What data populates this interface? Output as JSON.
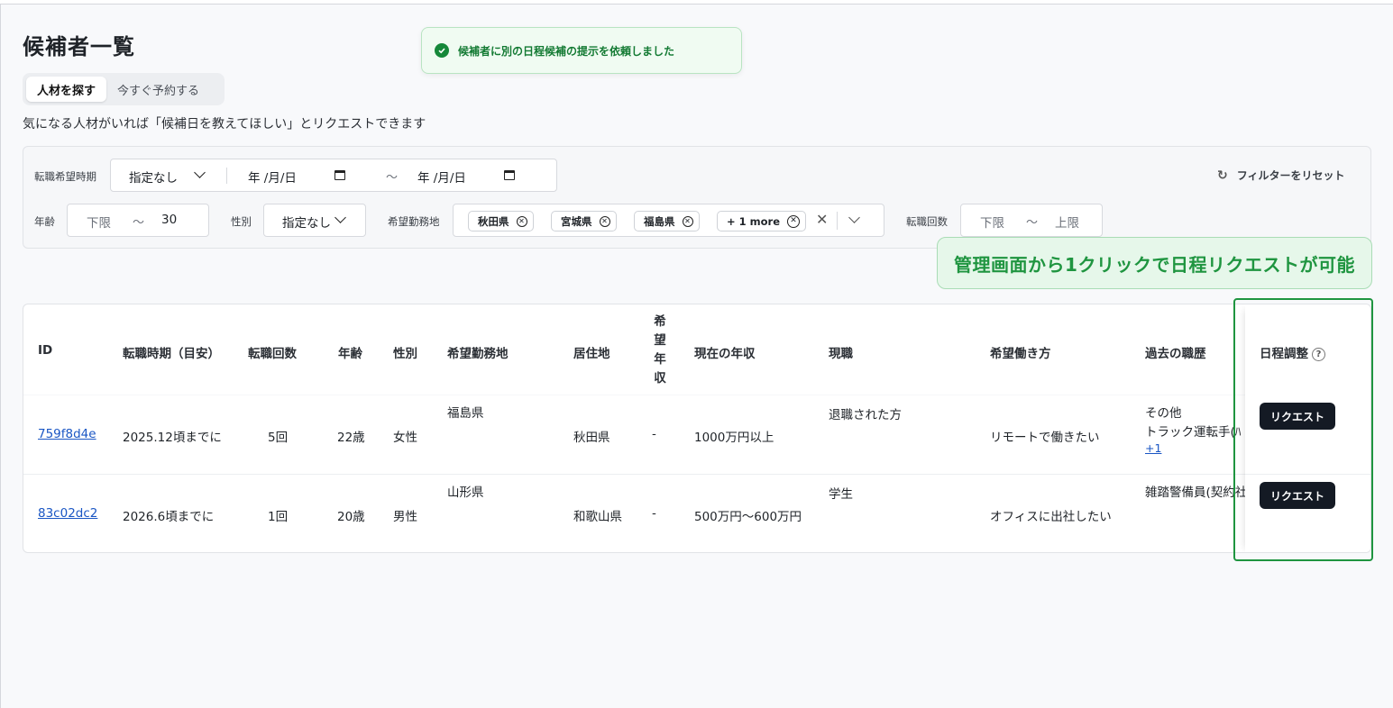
{
  "page": {
    "title": "候補者一覧"
  },
  "tabs": [
    {
      "label": "人材を探す",
      "active": true
    },
    {
      "label": "今すぐ予約する",
      "active": false
    }
  ],
  "subtitle": "気になる人材がいれば「候補日を教えてほしい」とリクエストできます",
  "toast": {
    "message": "候補者に別の日程候補の提示を依頼しました",
    "icon": "check-circle-icon"
  },
  "filters": {
    "change_period": {
      "label": "転職希望時期",
      "select_value": "指定なし",
      "date_from": "年 /月/日",
      "date_to": "年 /月/日",
      "separator": "～"
    },
    "age": {
      "label": "年齢",
      "min_placeholder": "下限",
      "separator": "～",
      "max_value": "30"
    },
    "gender": {
      "label": "性別",
      "select_value": "指定なし"
    },
    "location": {
      "label": "希望勤務地",
      "chips": [
        "秋田県",
        "宮城県",
        "福島県"
      ],
      "more": "+ 1 more"
    },
    "job_changes": {
      "label": "転職回数",
      "min_placeholder": "下限",
      "separator": "～",
      "max_placeholder": "上限"
    },
    "reset_label": "フィルターをリセット"
  },
  "callout": "管理画面から1クリックで日程リクエストが可能",
  "table": {
    "columns": {
      "id": "ID",
      "period": "転職時期（目安）",
      "changes": "転職回数",
      "age": "年齢",
      "gender": "性別",
      "desired_location": "希望勤務地",
      "residence": "居住地",
      "desired_income": [
        "希",
        "望",
        "年",
        "収"
      ],
      "current_income": "現在の年収",
      "current_job": "現職",
      "work_style": "希望働き方",
      "past_jobs": "過去の職歴",
      "schedule": "日程調整"
    },
    "rows": [
      {
        "id": "759f8d4e",
        "period": "2025.12頃までに",
        "changes": "5回",
        "age": "22歳",
        "gender": "女性",
        "desired_location": "福島県",
        "residence": "秋田県",
        "desired_income": "-",
        "current_income": "1000万円以上",
        "current_job": "退職された方",
        "work_style": "リモートで働きたい",
        "past_jobs": [
          "その他",
          "トラック運転手(ﾊ",
          "+1"
        ],
        "action": "リクエスト"
      },
      {
        "id": "83c02dc2",
        "period": "2026.6頃までに",
        "changes": "1回",
        "age": "20歳",
        "gender": "男性",
        "desired_location": "山形県",
        "residence": "和歌山県",
        "desired_income": "-",
        "current_income": "500万円〜600万円",
        "current_job": "学生",
        "work_style": "オフィスに出社したい",
        "past_jobs": [
          "雑踏警備員(契約社"
        ],
        "action": "リクエスト"
      }
    ]
  },
  "colors": {
    "accent_green": "#1f9540",
    "button_dark": "#141a24",
    "link_blue": "#1a56c4"
  }
}
